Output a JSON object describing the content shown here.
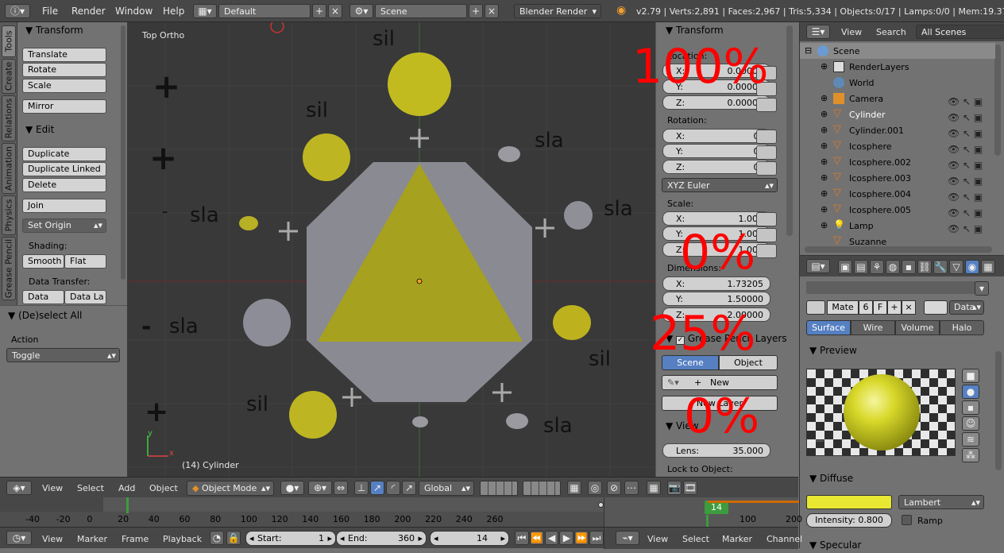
{
  "topbar": {
    "info_icon": "info-icon",
    "menus": [
      "File",
      "Render",
      "Window",
      "Help"
    ],
    "screen_layout": "Default",
    "scene": "Scene",
    "render_engine": "Blender Render",
    "stats": "v2.79 | Verts:2,891 | Faces:2,967 | Tris:5,334 | Objects:0/17 | Lamps:0/0 | Mem:19.37M | Cy"
  },
  "left_tabs": [
    "Tools",
    "Create",
    "Relations",
    "Animation",
    "Physics",
    "Grease Pencil"
  ],
  "toolshelf": {
    "transform_title": "Transform",
    "translate": "Translate",
    "rotate": "Rotate",
    "scale": "Scale",
    "mirror": "Mirror",
    "edit_title": "Edit",
    "duplicate": "Duplicate",
    "duplicate_linked": "Duplicate Linked",
    "delete": "Delete",
    "join": "Join",
    "set_origin": "Set Origin",
    "shading_label": "Shading:",
    "smooth": "Smooth",
    "flat": "Flat",
    "data_transfer_label": "Data Transfer:",
    "data": "Data",
    "data_la": "Data La",
    "operator_title": "(De)select All",
    "action_label": "Action",
    "action_value": "Toggle"
  },
  "viewport": {
    "view_name": "Top Ortho",
    "object_info": "(14) Cylinder",
    "overlay_words": {
      "sil1": "sil",
      "sil2": "sil",
      "sla1": "sla",
      "sla2": "sla",
      "sla3": "sla",
      "sla4": "sla",
      "sil3": "sil",
      "sil4": "sil",
      "sla5": "sla"
    },
    "minus1": "-",
    "minus2": "-",
    "axis_y": "y",
    "axis_x": "x"
  },
  "npanel": {
    "transform_title": "Transform",
    "location_label": "Location:",
    "loc": [
      {
        "k": "X:",
        "v": "0.00000"
      },
      {
        "k": "Y:",
        "v": "0.00000"
      },
      {
        "k": "Z:",
        "v": "0.00000"
      }
    ],
    "rotation_label": "Rotation:",
    "rot": [
      {
        "k": "X:",
        "v": "0°"
      },
      {
        "k": "Y:",
        "v": "0°"
      },
      {
        "k": "Z:",
        "v": "0°"
      }
    ],
    "rotation_mode": "XYZ Euler",
    "scale_label": "Scale:",
    "scale": [
      {
        "k": "X:",
        "v": "1.000"
      },
      {
        "k": "Y:",
        "v": "1.000"
      },
      {
        "k": "Z:",
        "v": "1.000"
      }
    ],
    "dimensions_label": "Dimensions:",
    "dim": [
      {
        "k": "X:",
        "v": "1.73205"
      },
      {
        "k": "Y:",
        "v": "1.50000"
      },
      {
        "k": "Z:",
        "v": "2.00000"
      }
    ],
    "grease_title": "Grease Pencil Layers",
    "scene_tab": "Scene",
    "object_tab": "Object",
    "new": "New",
    "new_layer": "New Layer",
    "view_title": "View",
    "lens_label": "Lens:",
    "lens_value": "35.000",
    "lock_to_object": "Lock to Object:",
    "red_overlays": [
      "100%",
      "0%",
      "25%",
      "0%"
    ]
  },
  "outliner": {
    "view": "View",
    "search": "Search",
    "filter": "All Scenes",
    "items": [
      "Scene",
      "RenderLayers",
      "World",
      "Camera",
      "Cylinder",
      "Cylinder.001",
      "Icosphere",
      "Icosphere.002",
      "Icosphere.003",
      "Icosphere.004",
      "Icosphere.005",
      "Lamp",
      "Suzanne"
    ]
  },
  "properties": {
    "material_name": "Mate",
    "users": "6",
    "fake": "F",
    "link": "Data",
    "tabs": [
      "Surface",
      "Wire",
      "Volume",
      "Halo"
    ],
    "preview_title": "Preview",
    "diffuse_title": "Diffuse",
    "diffuse_color": "#e8e832",
    "shader": "Lambert",
    "intensity": "Intensity: 0.800",
    "ramp": "Ramp",
    "specular_title": "Specular"
  },
  "view_header": {
    "menus": [
      "View",
      "Select",
      "Add",
      "Object"
    ],
    "mode": "Object Mode",
    "orientation": "Global"
  },
  "timeline": {
    "ticks": [
      "-40",
      "-20",
      "0",
      "20",
      "40",
      "60",
      "80",
      "100",
      "120",
      "140",
      "160",
      "180",
      "200",
      "220",
      "240",
      "260"
    ],
    "ticks2": [
      "100",
      "200"
    ],
    "current_frame_badge": "14"
  },
  "timeline_header": {
    "menus": [
      "View",
      "Marker",
      "Frame",
      "Playback"
    ],
    "start_label": "Start:",
    "start": "1",
    "end_label": "End:",
    "end": "360",
    "current": "14",
    "menus2": [
      "View",
      "Select",
      "Marker",
      "Channel"
    ]
  },
  "colors": {
    "yellow": "#b8b822",
    "select_blue": "#5680c2",
    "red_overlay": "#ff0000"
  }
}
